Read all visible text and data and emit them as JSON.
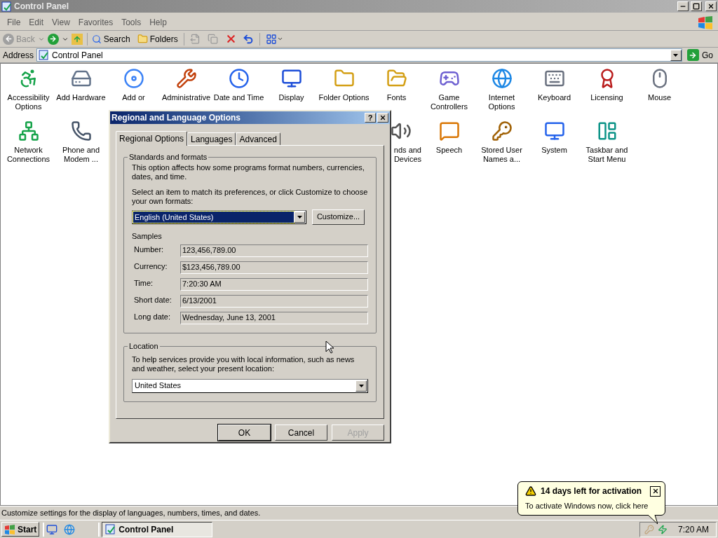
{
  "window": {
    "title": "Control Panel"
  },
  "menu": [
    "File",
    "Edit",
    "View",
    "Favorites",
    "Tools",
    "Help"
  ],
  "toolbar": {
    "back": {
      "label": "Back",
      "disabled": true
    },
    "search": "Search",
    "folders": "Folders"
  },
  "address": {
    "label": "Address",
    "value": "Control Panel",
    "go": "Go"
  },
  "icon_rows": [
    {
      "left": [
        {
          "label": "Accessibility Options"
        },
        {
          "label": "Add Hardware"
        },
        {
          "label": "Add or"
        },
        {
          "label": "Administrative"
        },
        {
          "label": "Date and Time"
        },
        {
          "label": "Display"
        },
        {
          "label": "Folder Options"
        },
        {
          "label": "Fonts"
        },
        {
          "label": "Game Controllers"
        },
        {
          "label": "Internet Options"
        },
        {
          "label": "Keyboard"
        },
        {
          "label": "Licensing"
        },
        {
          "label": "Mouse"
        }
      ]
    },
    {
      "left": [
        {
          "label": "Network Connections"
        },
        {
          "label": "Phone and Modem ..."
        }
      ],
      "right_of_dialog": [
        {
          "kind": "partial",
          "label": "nds and Devices"
        },
        {
          "label": "Speech"
        },
        {
          "label": "Stored User Names a..."
        },
        {
          "label": "System"
        },
        {
          "label": "Taskbar and Start Menu"
        }
      ]
    }
  ],
  "dialog": {
    "title": "Regional and Language Options",
    "help": "?",
    "tabs": [
      {
        "label": "Regional Options",
        "selected": true
      },
      {
        "label": "Languages",
        "selected": false
      },
      {
        "label": "Advanced",
        "selected": false
      }
    ],
    "standards": {
      "legend": "Standards and formats",
      "description": "This option affects how some programs format numbers, currencies, dates, and time.",
      "prompt": "Select an item to match its preferences, or click Customize to choose your own formats:",
      "format": "English (United States)",
      "customize": "Customize..."
    },
    "samples": {
      "label": "Samples",
      "rows": [
        {
          "label": "Number:",
          "value": "123,456,789.00"
        },
        {
          "label": "Currency:",
          "value": "$123,456,789.00"
        },
        {
          "label": "Time:",
          "value": "7:20:30 AM"
        },
        {
          "label": "Short date:",
          "value": "6/13/2001"
        },
        {
          "label": "Long date:",
          "value": "Wednesday, June 13, 2001"
        }
      ]
    },
    "location": {
      "legend": "Location",
      "description": "To help services provide you with local information, such as news and weather, select your present location:",
      "value": "United States"
    },
    "buttons": [
      {
        "label": "OK",
        "disabled": false,
        "default": true
      },
      {
        "label": "Cancel",
        "disabled": false,
        "default": false
      },
      {
        "label": "Apply",
        "disabled": true,
        "default": false
      }
    ]
  },
  "status_bar": "Customize settings for the display of languages, numbers, times, and dates.",
  "balloon": {
    "title": "14 days left for activation",
    "text": "To activate Windows now, click here"
  },
  "taskbar": {
    "start": "Start",
    "tasks": [
      {
        "label": "Control Panel",
        "selected": true
      }
    ],
    "clock": "7:20 AM"
  }
}
